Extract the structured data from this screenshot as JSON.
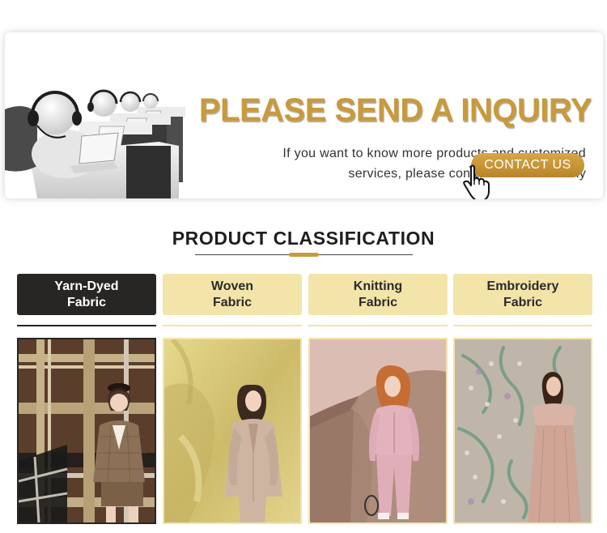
{
  "banner": {
    "title": "PLEASE SEND A INQUIRY",
    "subtitle_line1": "If you want to know more products and customized",
    "subtitle_line2": "services, please contact us immediately",
    "contact_label": "CONTACT US"
  },
  "section": {
    "title": "PRODUCT CLASSIFICATION"
  },
  "categories": [
    {
      "line1": "Yarn-Dyed",
      "line2": "Fabric",
      "active": true
    },
    {
      "line1": "Woven",
      "line2": "Fabric",
      "active": false
    },
    {
      "line1": "Knitting",
      "line2": "Fabric",
      "active": false
    },
    {
      "line1": "Embroidery",
      "line2": "Fabric",
      "active": false
    }
  ],
  "colors": {
    "accent_gold": "#c89a3c",
    "tab_inactive": "#f3e4a9",
    "tab_active": "#282624",
    "button_gradient_top": "#d8a644",
    "button_gradient_bottom": "#b8842a"
  },
  "icons": {
    "hand": "pointing-hand-cursor-icon",
    "support": "customer-support-agents-illustration"
  }
}
